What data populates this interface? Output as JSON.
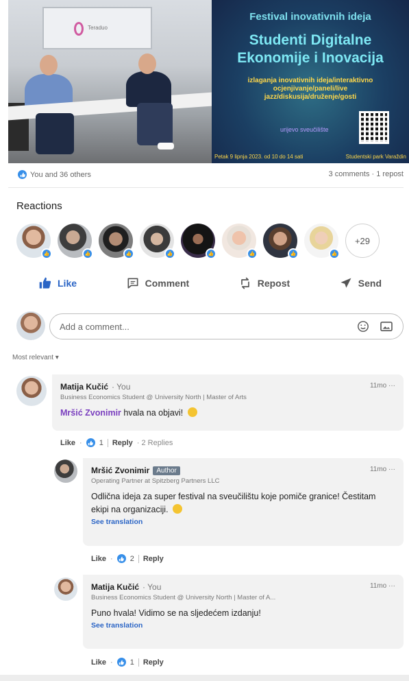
{
  "post_image": {
    "photo_screen_label": "Teraduo",
    "poster": {
      "festival_line": "Festival inovativnih ideja",
      "title_line1": "Studenti Digitalne",
      "title_line2": "Ekonomije i Inovacija",
      "description": "izlaganja inovativnih ideja/interaktivno ocjenjivanje/paneli/live jazz/diskusija/druženje/gosti",
      "small_text": "urijevo sveučilište",
      "footer_left": "Petak 9 lipnja 2023. od 10 do 14 sati",
      "footer_right": "Studentski park Varaždin"
    }
  },
  "social_counts": {
    "reactions_text": "You and 36 others",
    "comments_reposts_text": "3 comments · 1 repost"
  },
  "reactions": {
    "title": "Reactions",
    "more_count": "+29"
  },
  "actions": {
    "like": "Like",
    "comment": "Comment",
    "repost": "Repost",
    "send": "Send"
  },
  "comment_input": {
    "placeholder": "Add a comment..."
  },
  "sort_label": "Most relevant ▾",
  "comments": [
    {
      "name": "Matija Kučić",
      "you_label": "· You",
      "headline": "Business Economics Student @ University North | Master of Arts",
      "time": "11mo",
      "mention": "Mršić Zvonimir",
      "text": "hvala na objavi!",
      "like_label": "Like",
      "like_count": "1",
      "reply_label": "Reply",
      "replies_label": "· 2 Replies"
    },
    {
      "name": "Mršić Zvonimir",
      "author_tag": "Author",
      "headline": "Operating Partner at Spitzberg Partners LLC",
      "time": "11mo",
      "text": "Odlična ideja za super festival na sveučilištu koje pomiče granice! Čestitam ekipi na organizaciji.",
      "see_translation": "See translation",
      "like_label": "Like",
      "like_count": "2",
      "reply_label": "Reply"
    },
    {
      "name": "Matija Kučić",
      "you_label": "· You",
      "headline": "Business Economics Student @ University North | Master of A...",
      "time": "11mo",
      "text": "Puno hvala! Vidimo se na sljedećem izdanju!",
      "see_translation": "See translation",
      "like_label": "Like",
      "like_count": "1",
      "reply_label": "Reply"
    }
  ],
  "colors": {
    "link_blue": "#2a64c5",
    "reaction_blue": "#378fe9",
    "mention_purple": "#7a3fbf",
    "bubble_grey": "#f2f2f2"
  }
}
